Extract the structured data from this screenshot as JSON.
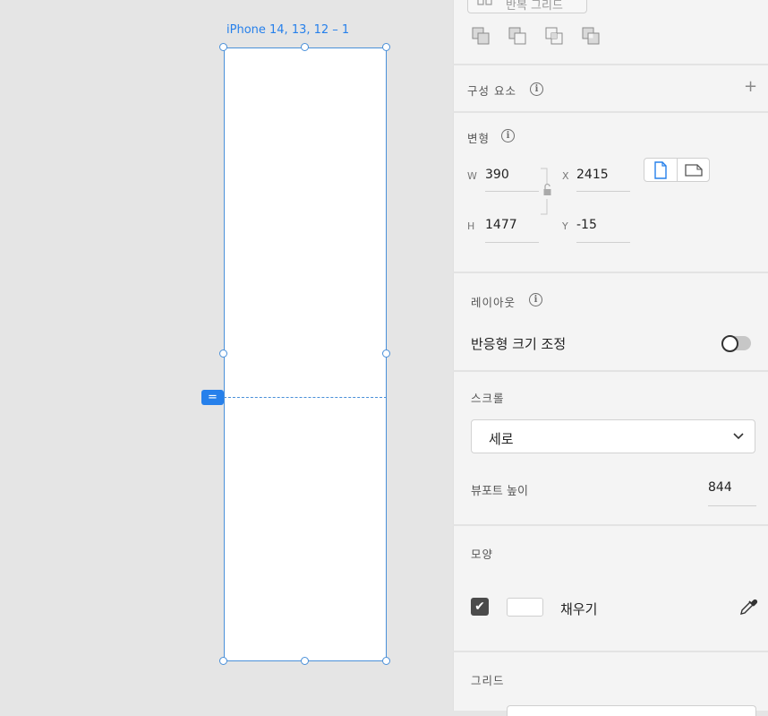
{
  "artboard": {
    "label": "iPhone 14, 13, 12 – 1"
  },
  "repeat_grid": {
    "label": "반복 그리드"
  },
  "components": {
    "title": "구성 요소",
    "add": "+"
  },
  "transform": {
    "title": "변형",
    "w_label": "W",
    "w_value": "390",
    "h_label": "H",
    "h_value": "1477",
    "x_label": "X",
    "x_value": "2415",
    "y_label": "Y",
    "y_value": "-15"
  },
  "layout": {
    "title": "레이아웃",
    "responsive_label": "반응형 크기 조정",
    "responsive_on": false
  },
  "scroll": {
    "title": "스크롤",
    "selected": "세로",
    "viewport_label": "뷰포트 높이",
    "viewport_value": "844"
  },
  "appearance": {
    "title": "모양",
    "fill_label": "채우기",
    "fill_checked": true,
    "fill_color": "#ffffff"
  },
  "grid": {
    "title": "그리드"
  },
  "colors": {
    "accent": "#2680eb",
    "selection": "#4a90d9"
  }
}
